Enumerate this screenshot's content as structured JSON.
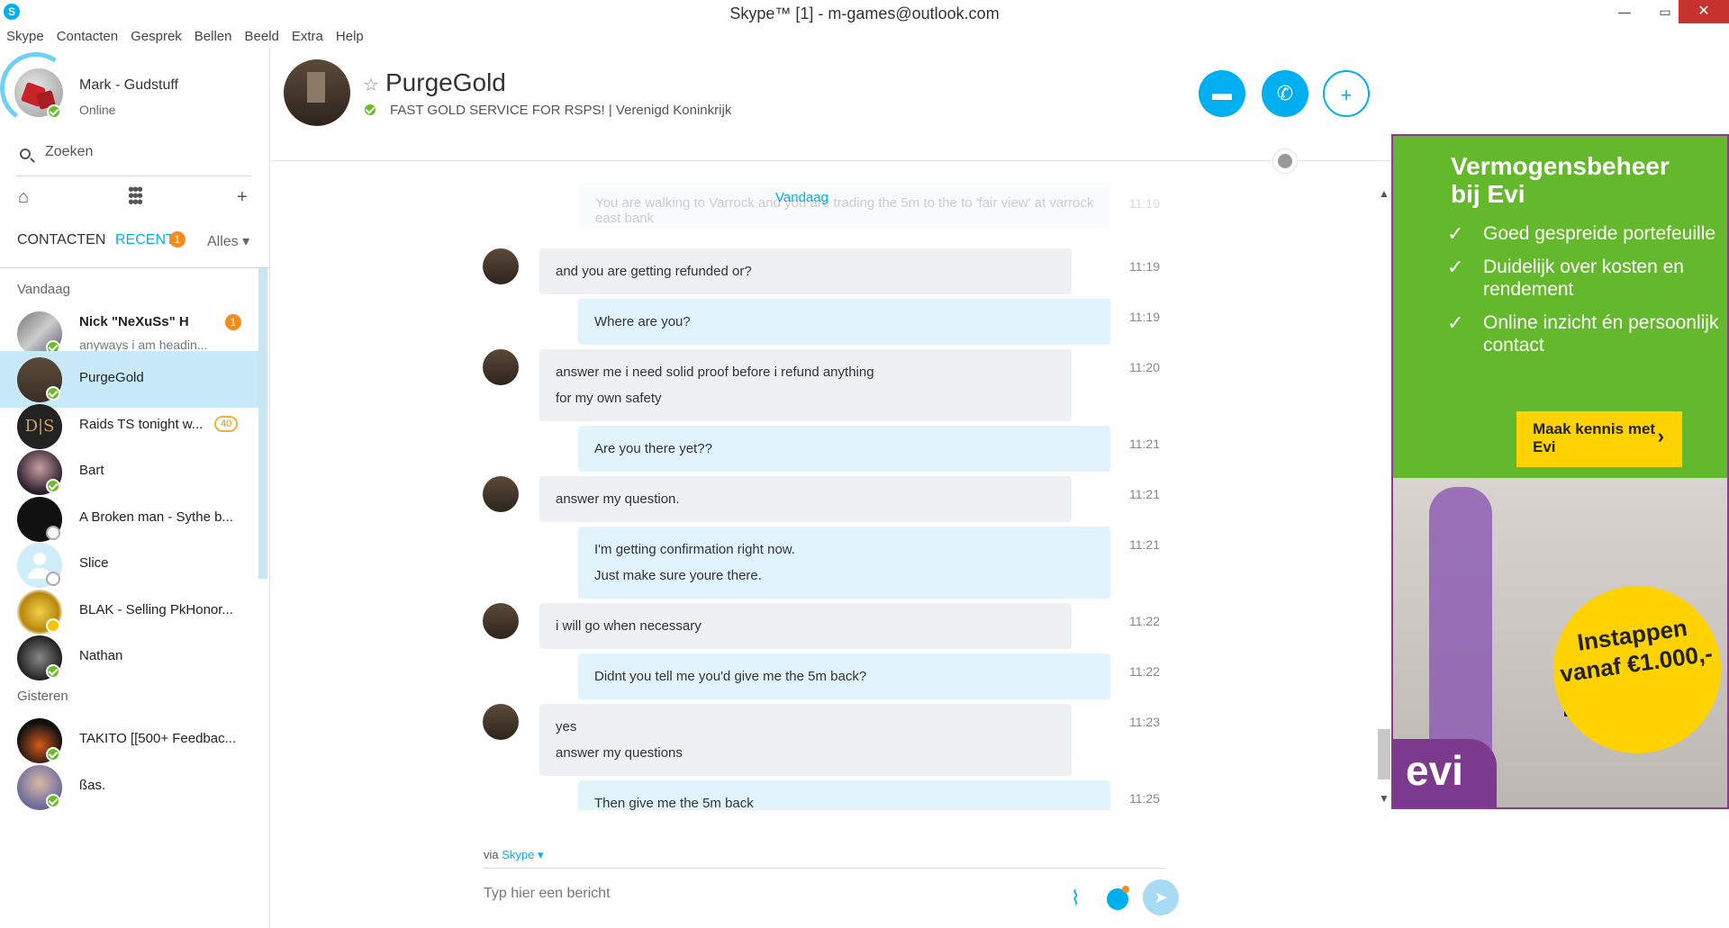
{
  "window": {
    "title": "Skype™ [1] - m-games@outlook.com",
    "app_icon": "skype-icon",
    "controls": {
      "minimize": "—",
      "maximize": "▭",
      "close": "✕"
    }
  },
  "menu": [
    "Skype",
    "Contacten",
    "Gesprek",
    "Bellen",
    "Beeld",
    "Extra",
    "Help"
  ],
  "profile": {
    "name": "Mark - Gudstuff",
    "status": "Online"
  },
  "search": {
    "placeholder": "Zoeken"
  },
  "tabs": {
    "contacts": "CONTACTEN",
    "recent": "RECENT",
    "recent_badge": "1",
    "filter": "Alles ▾"
  },
  "groups": {
    "today": "Vandaag",
    "yesterday": "Gisteren"
  },
  "contacts": [
    {
      "name": "Nick \"NeXuSs\" H",
      "sub": "anyways i am headin...",
      "badge": "1",
      "status": "online"
    },
    {
      "name": "PurgeGold",
      "status": "online",
      "selected": true
    },
    {
      "name": "Raids TS tonight w...",
      "badge": "40"
    },
    {
      "name": "Bart",
      "status": "online"
    },
    {
      "name": "A Broken man - Sythe b...",
      "status": "unknown"
    },
    {
      "name": "Slice",
      "status": "unknown"
    },
    {
      "name": "BLAK - Selling PkHonor...",
      "status": "away"
    },
    {
      "name": "Nathan",
      "status": "online"
    },
    {
      "name": "TAKITO [[500+ Feedbac...",
      "status": "online"
    },
    {
      "name": "ßas.",
      "status": "online"
    }
  ],
  "conversation": {
    "name": "PurgeGold",
    "mood": "FAST GOLD SERVICE FOR RSPS!  |  Verenigd Koninkrijk",
    "faded_message": "You are walking to Varrock and you are trading the 5m to the to 'fair view' at varrock east bank",
    "faded_time": "11:19",
    "day_separator": "Vandaag",
    "messages": [
      {
        "dir": "in",
        "lines": [
          "and you are getting refunded or?"
        ],
        "time": "11:19"
      },
      {
        "dir": "out",
        "lines": [
          "Where are you?"
        ],
        "time": "11:19"
      },
      {
        "dir": "in",
        "lines": [
          "answer me i need solid proof before i refund anything",
          "for my own safety"
        ],
        "time": "11:20"
      },
      {
        "dir": "out",
        "lines": [
          "Are you there yet??"
        ],
        "time": "11:21"
      },
      {
        "dir": "in",
        "lines": [
          "answer my question."
        ],
        "time": "11:21"
      },
      {
        "dir": "out",
        "lines": [
          "I'm getting confirmation right now.",
          "Just make sure youre there."
        ],
        "time": "11:21"
      },
      {
        "dir": "in",
        "lines": [
          "i will go when necessary"
        ],
        "time": "11:22"
      },
      {
        "dir": "out",
        "lines": [
          "Didnt you tell me you'd give me the 5m back?"
        ],
        "time": "11:22"
      },
      {
        "dir": "in",
        "lines": [
          "yes",
          "answer my questions"
        ],
        "time": "11:23"
      },
      {
        "dir": "out",
        "lines": [
          "Then give me the 5m back"
        ],
        "time": "11:25"
      }
    ],
    "via_prefix": "via",
    "via_link": "Skype ▾",
    "compose_placeholder": "Typ hier een bericht"
  },
  "ad": {
    "headline": "Vermogensbeheer bij Evi",
    "bullets": [
      "Goed gespreide portefeuille",
      "Duidelijk over kosten en rendement",
      "Online inzicht én persoonlijk contact"
    ],
    "cta": "Maak kennis met Evi",
    "offer": "Instappen vanaf €1.000,-",
    "logo": "evi"
  },
  "colors": {
    "accent": "#00aff0",
    "selected": "#c8eaf8",
    "online": "#6cbb2a",
    "badge": "#f28c1c",
    "ad_green": "#63b82b"
  }
}
